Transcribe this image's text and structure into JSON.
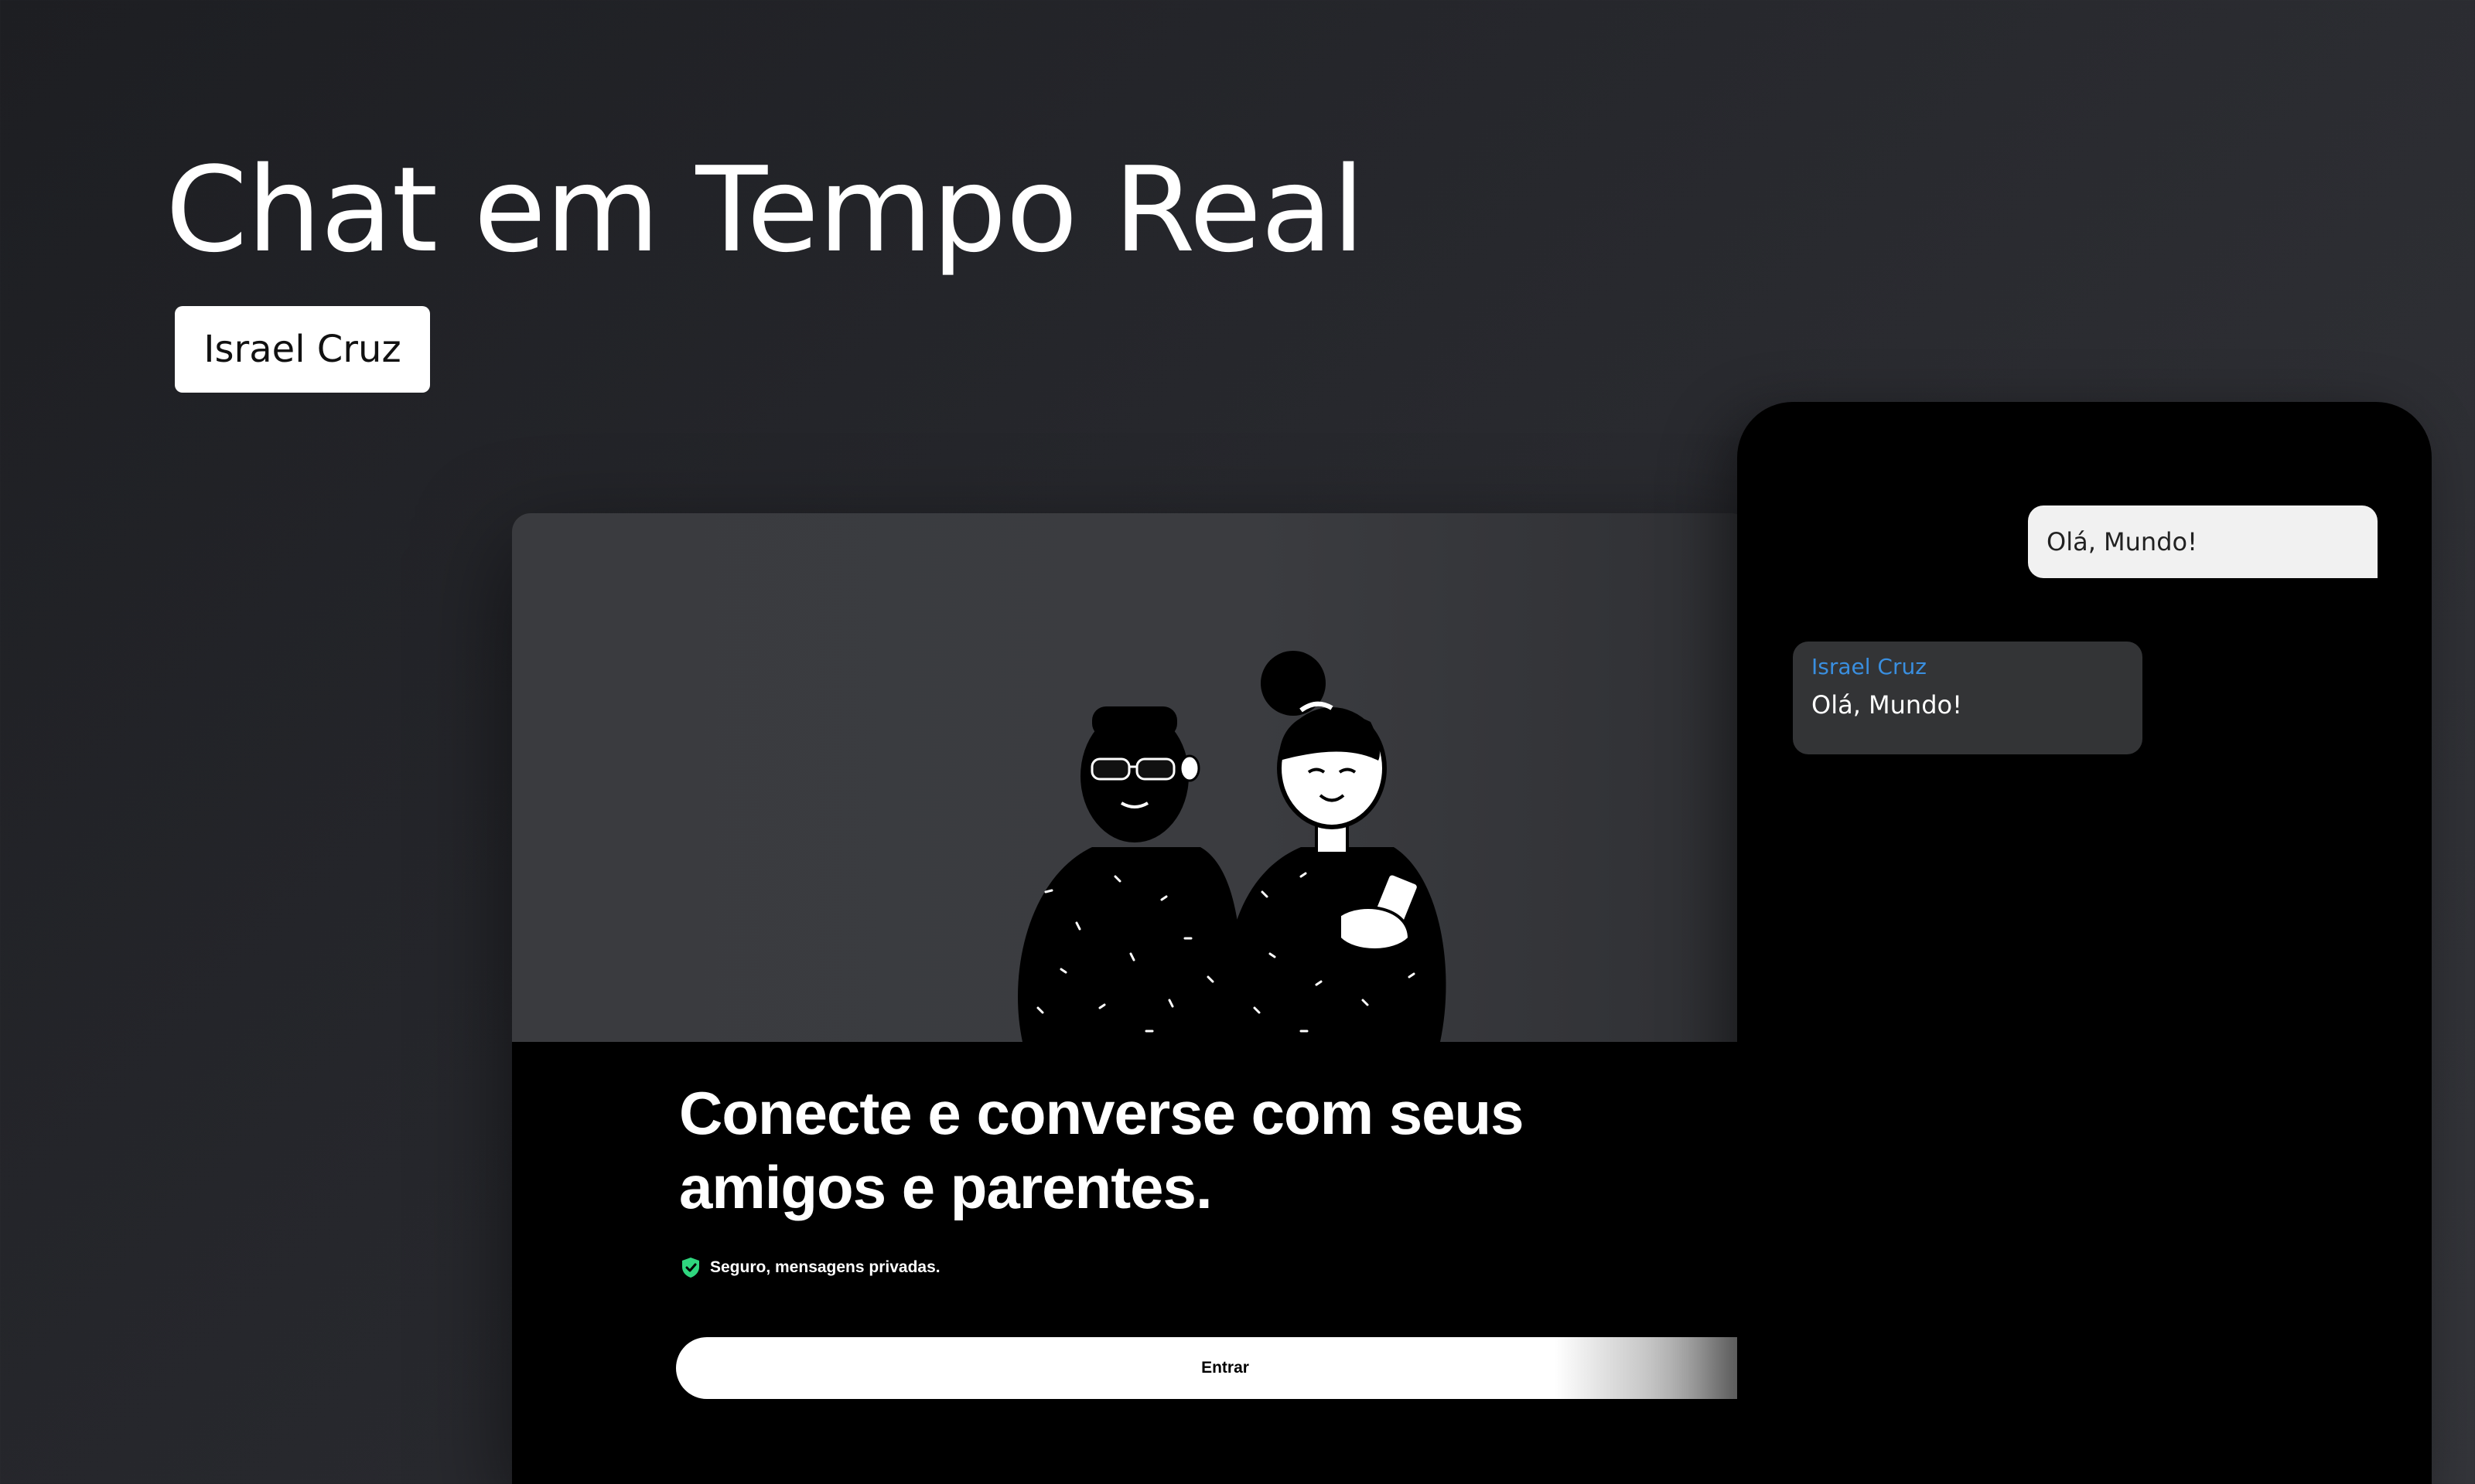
{
  "header": {
    "title": "Chat em Tempo Real",
    "author": "Israel Cruz"
  },
  "login": {
    "headline": "Conecte e converse com seus amigos e parentes.",
    "secure_text": "Seguro, mensagens privadas.",
    "enter_label": "Entrar",
    "icons": {
      "secure": "shield-check-icon",
      "illustration": "two-people-illustration"
    },
    "colors": {
      "secure_icon": "#2fd67e",
      "background": "#000000"
    }
  },
  "chat": {
    "messages": [
      {
        "direction": "sent",
        "text": "Olá, Mundo!"
      },
      {
        "direction": "received",
        "author": "Israel Cruz",
        "text": "Olá, Mundo!"
      }
    ],
    "colors": {
      "author_name": "#3a8fe0",
      "sent_bubble": "#f1f1f1",
      "received_bubble": "#333436"
    }
  }
}
